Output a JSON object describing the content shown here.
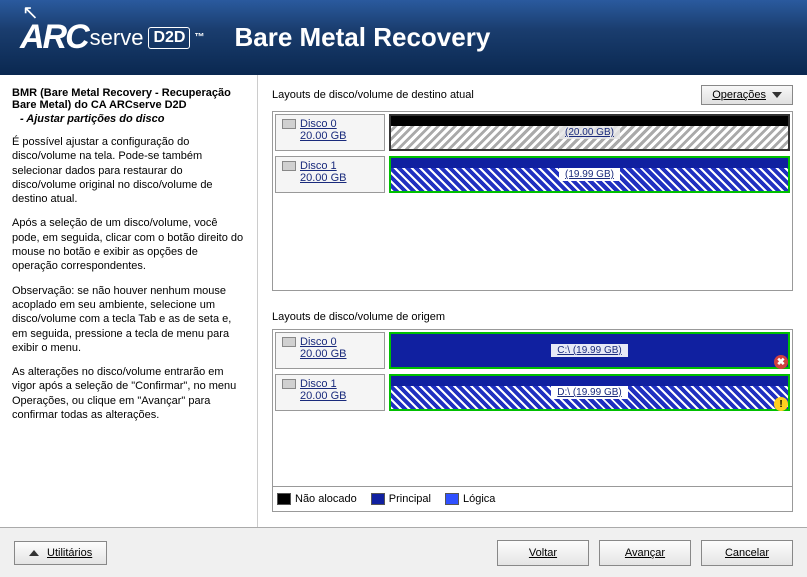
{
  "header": {
    "logo_arc": "ARC",
    "logo_serve": "serve",
    "logo_d2d": "D2D",
    "title": "Bare Metal Recovery"
  },
  "sidebar": {
    "title": "BMR (Bare Metal Recovery - Recuperação Bare Metal) do CA ARCserve D2D",
    "subtitle": "- Ajustar partições do disco",
    "p1": "É possível ajustar a configuração do disco/volume na tela. Pode-se também selecionar dados para restaurar do disco/volume original no disco/volume de destino atual.",
    "p2": "Após a seleção de um disco/volume, você pode, em seguida, clicar com o botão direito do mouse no botão e exibir as opções de operação correspondentes.",
    "p3": "Observação: se não houver nenhum mouse acoplado em seu ambiente, selecione um disco/volume com a tecla Tab e as de seta e, em seguida, pressione a tecla de menu para exibir o menu.",
    "p4": "As alterações no disco/volume entrarão em vigor após a seleção de \"Confirmar\", no menu Operações, ou clique em \"Avançar\" para confirmar todas as alterações."
  },
  "content": {
    "dest_label": "Layouts de disco/volume de destino atual",
    "source_label": "Layouts de disco/volume de origem",
    "ops_button": "Operações",
    "dest_disks": [
      {
        "name": "Disco 0",
        "size": "20.00 GB",
        "volume_label": "(20.00 GB)",
        "style": "hatch-gray"
      },
      {
        "name": "Disco 1",
        "size": "20.00 GB",
        "volume_label": "(19.99 GB)",
        "style": "hatch-blue"
      }
    ],
    "source_disks": [
      {
        "name": "Disco 0",
        "size": "20.00 GB",
        "volume_label": "C:\\ (19.99 GB)",
        "style": "solid-blue",
        "status": "error"
      },
      {
        "name": "Disco 1",
        "size": "20.00 GB",
        "volume_label": "D:\\ (19.99 GB)",
        "style": "hatch-blue",
        "status": "warn"
      }
    ],
    "legend": {
      "unallocated": "Não alocado",
      "primary": "Principal",
      "logical": "Lógica"
    }
  },
  "footer": {
    "utilities": "Utilitários",
    "back": "Voltar",
    "next": "Avançar",
    "cancel": "Cancelar"
  }
}
